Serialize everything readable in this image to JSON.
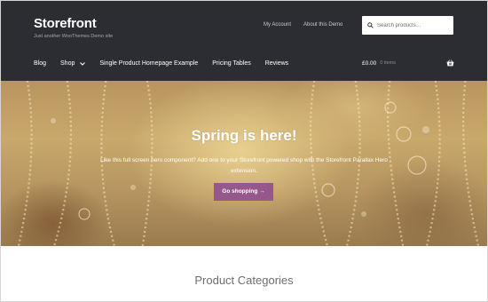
{
  "header": {
    "site_title": "Storefront",
    "tagline": "Just another WooThemes Demo site",
    "secondary_nav": [
      "My Account",
      "About this Demo"
    ],
    "search_placeholder": "Search products…",
    "primary_nav": [
      "Blog",
      "Shop",
      "Single Product Homepage Example",
      "Pricing Tables",
      "Reviews"
    ],
    "cart": {
      "total": "£0.00",
      "count": "0 items"
    }
  },
  "hero": {
    "title": "Spring is here!",
    "text": "Like this full screen hero component? Add one to your Storefront powered shop with the Storefront Parallax Hero extension.",
    "button_label": "Go shopping →"
  },
  "content": {
    "section_title": "Product Categories"
  },
  "colors": {
    "header_bg": "#2c2d33",
    "button_accent": "#96588a",
    "text_gray": "#6d6d6d"
  }
}
